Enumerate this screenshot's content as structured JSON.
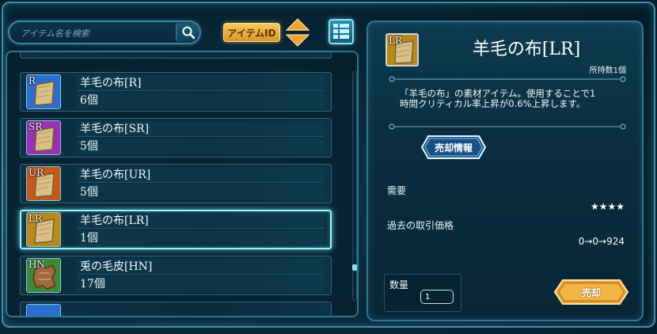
{
  "search": {
    "placeholder": "アイテム名を検索"
  },
  "toolbar": {
    "item_id_label": "アイテムID"
  },
  "items": [
    {
      "rank": "R",
      "name": "羊毛の布[R]",
      "count": "6個",
      "color": "#2a6fd0"
    },
    {
      "rank": "SR",
      "name": "羊毛の布[SR]",
      "count": "5個",
      "color": "#9a2fb8"
    },
    {
      "rank": "UR",
      "name": "羊毛の布[UR]",
      "count": "5個",
      "color": "#c55a1c"
    },
    {
      "rank": "LR",
      "name": "羊毛の布[LR]",
      "count": "1個",
      "color": "#b88a1c",
      "selected": true
    },
    {
      "rank": "HN",
      "name": "兎の毛皮[HN]",
      "count": "17個",
      "color": "#3f8a3a"
    }
  ],
  "detail": {
    "rank": "LR",
    "title": "羊毛の布[LR]",
    "owned": "所持数1個",
    "description_line1": "「羊毛の布」の素材アイテム。使用することで1",
    "description_line2": "時間クリティカル率上昇が0.6%上昇します。",
    "sale_info_label": "売却情報",
    "demand_label": "需要",
    "demand_value": "★★★★",
    "price_label": "過去の取引価格",
    "price_value": "0→0→924",
    "quantity_label": "数量",
    "quantity_value": "1",
    "sell_label": "売却"
  },
  "colors": {
    "accent": "#3f8fae",
    "gold": "#f0b440",
    "selection": "#9ef2ff"
  }
}
